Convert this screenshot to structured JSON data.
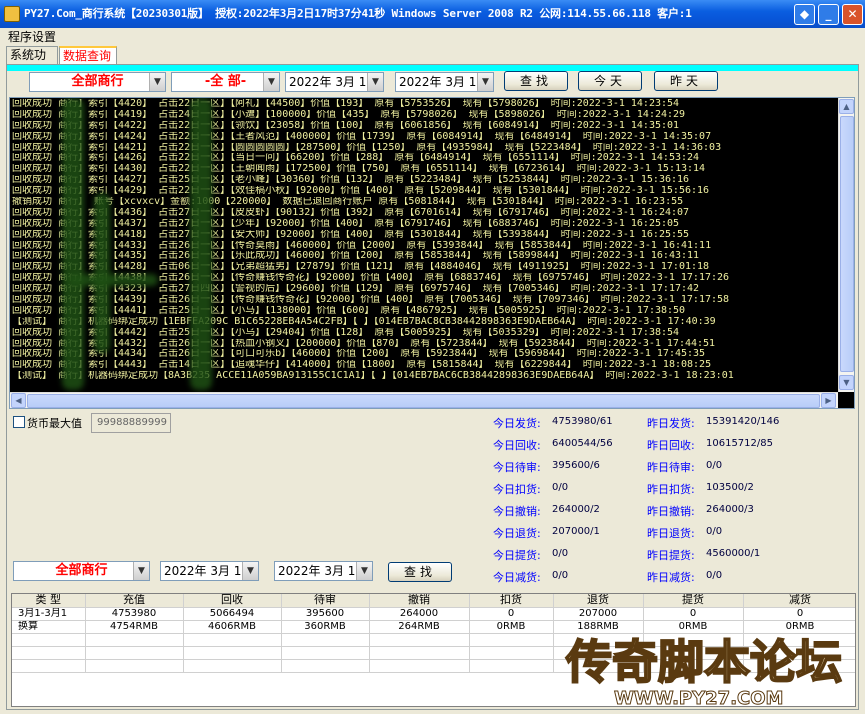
{
  "window": {
    "title": "PY27.Com_商行系统【20230301版】  授权:2022年3月2日17时37分41秒  Windows Server 2008 R2  公网:114.55.66.118  客户:1",
    "buttons": {
      "minimize": "_",
      "maximize": "□",
      "close": "✕"
    }
  },
  "menu": {
    "settings": "程序设置"
  },
  "tabs": [
    {
      "label": "系统功能"
    },
    {
      "label": "数据查询"
    }
  ],
  "query": {
    "merchant": "全部商行",
    "type": "-全  部-",
    "date_from": "2022年 3月 1日",
    "date_to": "2022年 3月 1日",
    "search": "查找",
    "today": "今天",
    "yesterday": "昨天"
  },
  "log_lines": [
    "回收成功  商行】索引【4420】   占击22日一区】【阿礼】【44500】价值【193】   原有【5753526】  现有【5798026】  时间:2022-3-1 14:23:54",
    "回收成功  商行】索引【4419】   占击24日一区】【小遭】【100000】价值【435】  原有【5798026】  现有【5898026】  时间:2022-3-1 14:24:29",
    "回收成功  商行】索引【4422】   占击22日一区】【领饮】【23058】价值【100】   原有【6061856】  现有【6084914】  时间:2022-3-1 14:35:01",
    "回收成功  商行】索引【4424】   占击22日一区】【王者风范】【400000】价值【1739】  原有【6084914】  现有【6484914】  时间:2022-3-1 14:35:07",
    "回收成功  商行】索引【4421】   占击22日一区】【圆圆圆圆圆】【287500】价值【1250】  原有【4935984】  现有【5223484】  时间:2022-3-1 14:36:03",
    "回收成功  商行】索引【4426】   占击22日一区】【当日一问】【66200】价值【288】   原有【6484914】  现有【6551114】  时间:2022-3-1 14:53:24",
    "回收成功  商行】索引【4430】   占击22日一区】【王朝闻雨】【172500】价值【750】  原有【6551114】  现有【6723614】  时间:2022-3-1 15:13:14",
    "回收成功  商行】索引【4427】   占击25日一区】【老小峰】【30360】价值【132】   原有【5223484】  现有【5253844】  时间:2022-3-1 15:36:16",
    "回收成功  商行】索引【4429】   占击22日一区】【效佳稿小秋】【92000】价值【400】  原有【5209844】  现有【5301844】  时间:2022-3-1 15:56:16",
    "撤销成功  商行】        账号【xcvxcv】金额:1000【220000】  数据已退回商行账户  原有【5081844】  现有【5301844】  时间:2022-3-1 16:23:55",
    "回收成功  商行】索引【4436】   占击27日一区】【皮皮虾】【90132】价值【392】  原有【6701614】  现有【6791746】  时间:2022-3-1 16:24:07",
    "回收成功  商行】索引【4437】   占击27日一区】【少年】【92000】价值【400】   原有【6791746】  现有【6883746】  时间:2022-3-1 16:25:05",
    "回收成功  商行】索引【4418】   占击27日一区】【安大师】【92000】价值【400】  原有【5301844】  现有【5393844】  时间:2022-3-1 16:25:55",
    "回收成功  商行】索引【4433】   占击26日一区】【传奇莫雨】【460000】价值【2000】  原有【5393844】  现有【5853844】  时间:2022-3-1 16:41:11",
    "回收成功  商行】索引【4435】   占击26日一区】【乐此成功】【46000】价值【200】  原有【5853844】  现有【5899844】  时间:2022-3-1 16:43:11",
    "回收成功  商行】索引【4428】   占击06日一区】【兄弟超猛男】【27879】价值【121】  原有【4884046】  现有【4911925】  时间:2022-3-1 17:01:18",
    "回收成功  商行】索引【4438】   占击26日一区】【传奇赚钱传奇花】【92000】价值【400】  原有【6883746】  现有【6975746】  时间:2022-3-1 17:17:26",
    "回收成功  商行】索引【4323】   占击27日四区】【警视的后】【29600】价值【129】  原有【6975746】  现有【7005346】  时间:2022-3-1 17:17:42",
    "回收成功  商行】索引【4439】   占击26日一区】【传奇赚钱传奇花】【92000】价值【400】  原有【7005346】  现有【7097346】  时间:2022-3-1 17:17:58",
    "回收成功  商行】索引【4441】   占击25日一区】【小马】【138000】价值【600】  原有【4867925】  现有【5005925】  时间:2022-3-1 17:38:50",
    "【测试】  商行】机器码绑定成功【1EBFEA209C    B1C65228EB4A54C2FB】【 】【014EB7BAC8CB38442898363E9DAEB64A】  时间:2022-3-1 17:40:39",
    "回收成功  商行】索引【4442】   占击25日一区】【小乌】【29404】价值【128】  原有【5005925】  现有【5035329】  时间:2022-3-1 17:38:54",
    "回收成功  商行】索引【4432】   占击26日一区】【热血小钢叉】【200000】价值【870】  原有【5723844】  现有【5923844】  时间:2022-3-1 17:44:51",
    "回收成功  商行】索引【4434】   占击26日一区】【可口可乐b】【46000】价值【200】  原有【5923844】  现有【5969844】  时间:2022-3-1 17:45:35",
    "回收成功  商行】索引【4443】   占击14日一区】【追魂华仔】【414000】价值【1800】  原有【5815844】  现有【6229844】  时间:2022-3-1 18:08:25",
    "【测试】  商行】机器码绑定成功【8A3B235 ACCE11A059BA913155C1C1A1】【 】【014EB7BAC6CB38442898363E9DAEB64A】  时间:2022-3-1 18:23:01"
  ],
  "currency_max": {
    "label": "货币最大值",
    "value": "99988889999"
  },
  "stats": {
    "today": [
      {
        "label": "今日发货:",
        "value": "4753980/61"
      },
      {
        "label": "今日回收:",
        "value": "6400544/56"
      },
      {
        "label": "今日待审:",
        "value": "395600/6"
      },
      {
        "label": "今日扣货:",
        "value": "0/0"
      },
      {
        "label": "今日撤销:",
        "value": "264000/2"
      },
      {
        "label": "今日退货:",
        "value": "207000/1"
      },
      {
        "label": "今日提货:",
        "value": "0/0"
      },
      {
        "label": "今日减货:",
        "value": "0/0"
      }
    ],
    "yesterday": [
      {
        "label": "昨日发货:",
        "value": "15391420/146"
      },
      {
        "label": "昨日回收:",
        "value": "10615712/85"
      },
      {
        "label": "昨日待审:",
        "value": "0/0"
      },
      {
        "label": "昨日扣货:",
        "value": "103500/2"
      },
      {
        "label": "昨日撤销:",
        "value": "264000/3"
      },
      {
        "label": "昨日退货:",
        "value": "0/0"
      },
      {
        "label": "昨日提货:",
        "value": "4560000/1"
      },
      {
        "label": "昨日减货:",
        "value": "0/0"
      }
    ]
  },
  "bottom_query": {
    "merchant": "全部商行",
    "date_from": "2022年 3月 1日",
    "date_to": "2022年 3月 1日",
    "search": "查找"
  },
  "table": {
    "headers": [
      "类 型",
      "充值",
      "回收",
      "待审",
      "撤销",
      "扣货",
      "退货",
      "提货",
      "减货"
    ],
    "rows": [
      [
        "3月1-3月1",
        "4753980",
        "5066494",
        "395600",
        "264000",
        "0",
        "207000",
        "0",
        "0"
      ],
      [
        "换算",
        "4754RMB",
        "4606RMB",
        "360RMB",
        "264RMB",
        "0RMB",
        "188RMB",
        "0RMB",
        "0RMB"
      ]
    ]
  },
  "watermark": {
    "title": "传奇脚本论坛",
    "url": "WWW.PY27.COM"
  }
}
